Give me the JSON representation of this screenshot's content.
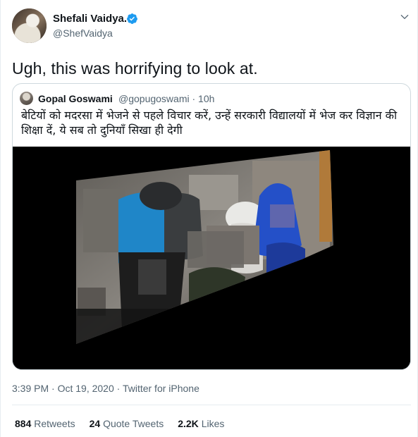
{
  "author": {
    "name": "Shefali Vaidya.",
    "handle": "@ShefVaidya",
    "verified": true
  },
  "tweet": {
    "text": "Ugh, this was horrifying to look at."
  },
  "quoted_tweet": {
    "author_name": "Gopal Goswami",
    "handle_time": "@gopugoswami · 10h",
    "text": "बेटियों को मदरसा में भेजने से पहले विचार करें, उन्हें सरकारी विद्यालयों में भेज कर विज्ञान की शिक्षा दें, ये सब तो दुनियाँ सिखा ही देगी"
  },
  "meta": {
    "time_date": "3:39 PM · Oct 19, 2020 · ",
    "source": "Twitter for iPhone"
  },
  "stats": {
    "retweets_count": "884",
    "retweets_label": "Retweets",
    "quotes_count": "24",
    "quotes_label": "Quote Tweets",
    "likes_count": "2.2K",
    "likes_label": "Likes"
  },
  "colors": {
    "verified": "#1d9bf0",
    "secondary_text": "#536471",
    "border": "#cfd9de"
  },
  "icons": {
    "verified": "verified-badge-icon",
    "more": "chevron-down-icon"
  }
}
